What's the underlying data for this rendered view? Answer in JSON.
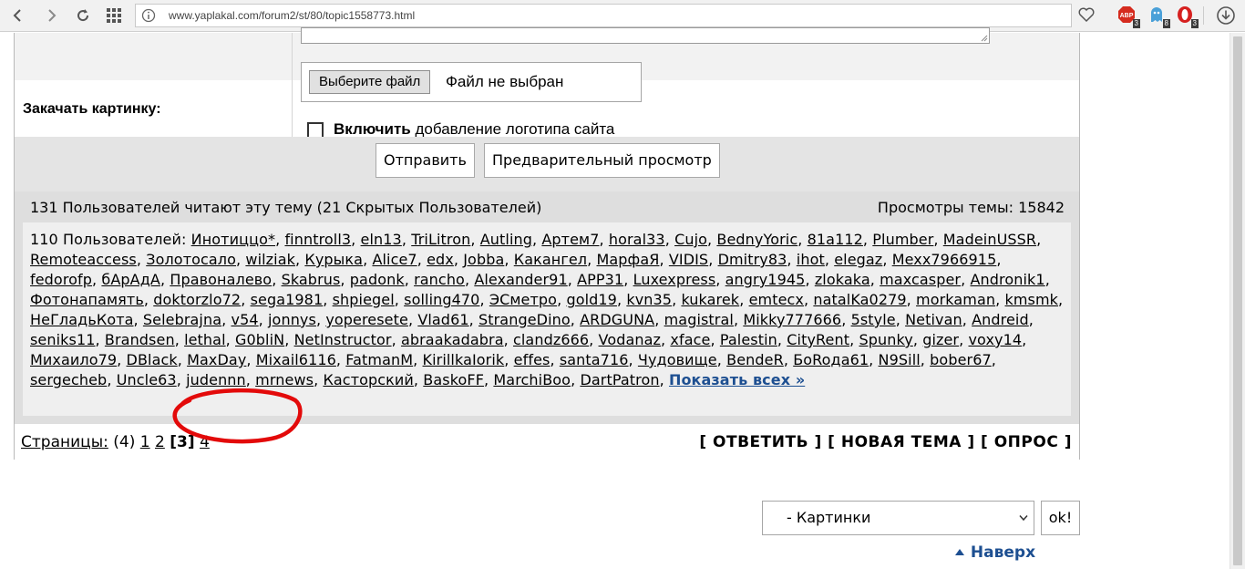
{
  "browser": {
    "url": "www.yaplakal.com/forum2/st/80/topic1558773.html",
    "extensions": [
      {
        "icon": "adblock-icon",
        "badge": "3"
      },
      {
        "icon": "ghost-icon",
        "badge": "8"
      },
      {
        "icon": "opera-addon-icon",
        "badge": "3"
      }
    ]
  },
  "form": {
    "upload_label": "Закачать картинку:",
    "file_button": "Выберите файл",
    "file_status": "Файл не выбран",
    "logo_bold": "Включить",
    "logo_rest": " добавление логотипа сайта",
    "logo_checked": false,
    "submit": "Отправить",
    "preview": "Предварительный просмотр"
  },
  "readers": {
    "header": "131 Пользователей читают эту тему (21 Скрытых Пользователей)",
    "views": "Просмотры темы: 15842",
    "prefix": "110 Пользователей:",
    "users": [
      "Инотиццо*",
      "finntroll3",
      "eln13",
      "TriLitron",
      "Autling",
      "Артем7",
      "horal33",
      "Cujo",
      "BednyYoric",
      "81a112",
      "Plumber",
      "MadeinUSSR",
      "Remoteaccess",
      "Золотосало",
      "wilziak",
      "Курыка",
      "Alice7",
      "edx",
      "Jobba",
      "Какангел",
      "МарфаЯ",
      "VIDIS",
      "Dmitry83",
      "ihot",
      "elegaz",
      "Mexx7966915",
      "fedorofp",
      "бАрАдА",
      "Правоналево",
      "Skabrus",
      "padonk",
      "rancho",
      "Alexander91",
      "APP31",
      "Luxexpress",
      "angry1945",
      "zlokaka",
      "maxcasper",
      "Andronik1",
      "Фотонапамять",
      "doktorzlo72",
      "sega1981",
      "shpiegel",
      "solling470",
      "ЭСметро",
      "gold19",
      "kvn35",
      "kukarek",
      "emtecx",
      "natalKa0279",
      "morkaman",
      "kmsmk",
      "НеГладьКота",
      "Selebrajna",
      "v54",
      "jonnys",
      "yoperesete",
      "Vlad61",
      "StrangeDino",
      "ARDGUNA",
      "magistral",
      "Mikky777666",
      "5style",
      "Netivan",
      "Andreid",
      "seniks11",
      "Brandsen",
      "lethal",
      "G0bliN",
      "NetInstructor",
      "abraakadabra",
      "clandz666",
      "Vodanaz",
      "xface",
      "Palestin",
      "CityRent",
      "Spunky",
      "gizer",
      "voxy14",
      "Михаило79",
      "DBlack",
      "MaxDay",
      "Mixail6116",
      "FatmanM",
      "KirillkaIorik",
      "effes",
      "santa716",
      "Чудовище",
      "BendeR",
      "БоRoда61",
      "N9Sill",
      "bober67",
      "sergecheb",
      "Uncle63",
      "judennn",
      "mrnews",
      "Касторский",
      "BaskoFF",
      "MarchiBoo",
      "DartPatron"
    ],
    "show_all": "Показать всех »"
  },
  "pagination": {
    "label": "Страницы:",
    "total": "(4)",
    "pages": [
      "1",
      "2",
      "3",
      "4"
    ],
    "current": "3"
  },
  "actions": {
    "reply": "[ ОТВЕТИТЬ ]",
    "new_topic": "[ НОВАЯ ТЕМА ]",
    "poll": "[ ОПРОС ]"
  },
  "jump": {
    "selected": "- Картинки",
    "ok": "ok!"
  },
  "up_link": "Наверх"
}
